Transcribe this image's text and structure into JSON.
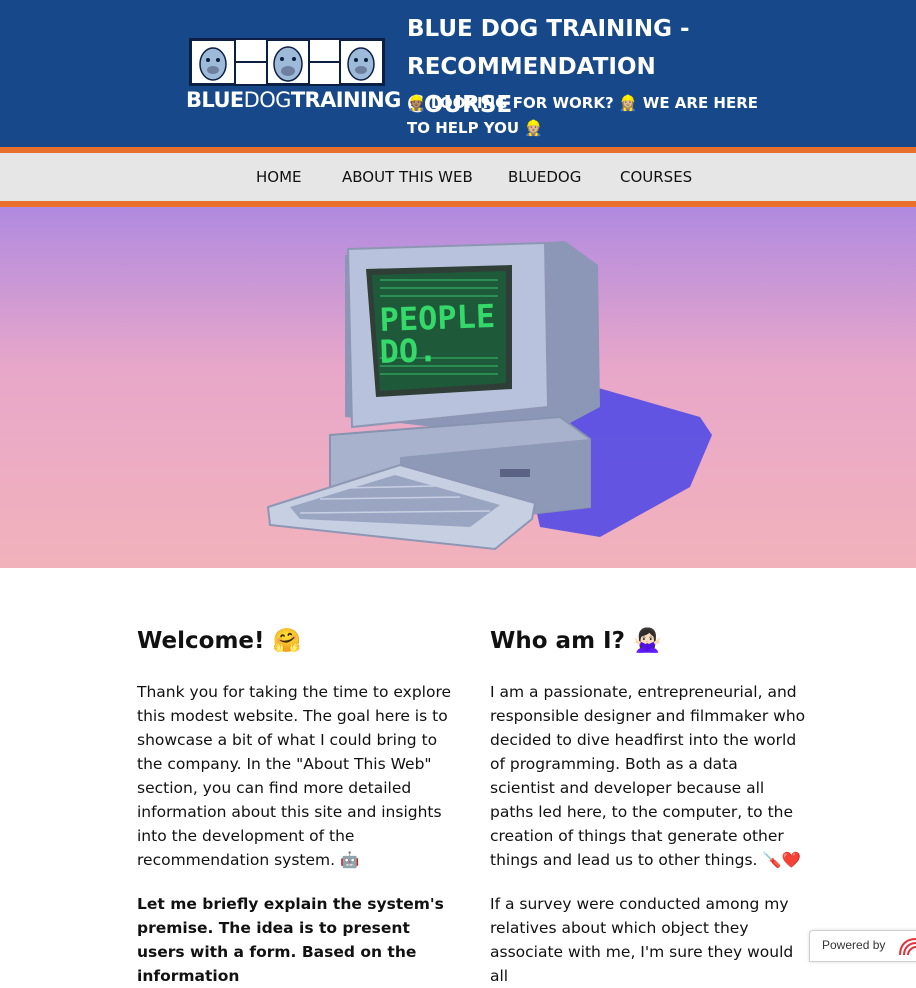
{
  "header": {
    "logo_text_bold1": "BLUE",
    "logo_text_light": "DOG",
    "logo_text_bold2": "TRAINING",
    "title": "BLUE DOG TRAINING - RECOMMENDATION COURSE",
    "tagline": "👷🏽 LOOKING FOR WORK? 👷🏼‍♀️ WE ARE HERE TO HELP YOU 👷🏼"
  },
  "nav": {
    "items": [
      {
        "label": "HOME"
      },
      {
        "label": "ABOUT THIS WEB"
      },
      {
        "label": "BLUEDOG"
      },
      {
        "label": "COURSES"
      }
    ]
  },
  "hero": {
    "screen_text_line1": "PEOPLE",
    "screen_text_line2": "DO."
  },
  "welcome": {
    "heading": "Welcome! 🤗",
    "paragraph1": "Thank you for taking the time to explore this modest website. The goal here is to showcase a bit of what I could bring to the company. In the \"About This Web\" section, you can find more detailed information about this site and insights into the development of the recommendation system. 🤖",
    "paragraph2": "Let me briefly explain the system's premise. The idea is to present users with a form. Based on the information"
  },
  "about": {
    "heading": "Who am I? 🙅🏻‍♀️",
    "paragraph1": "I am a passionate, entrepreneurial, and responsible designer and filmmaker who decided to dive headfirst into the world of programming. Both as a data scientist and developer because all paths led here, to the computer, to the creation of things that generate other things and lead us to other things. 🪛❤️",
    "paragraph2": "If a survey were conducted among my relatives about which object they associate with me, I'm sure they would all"
  },
  "footer_badge": {
    "label": "Powered by"
  },
  "colors": {
    "header_bg": "#17498a",
    "accent_orange": "#e8702a",
    "nav_bg": "#e6e6e6"
  }
}
